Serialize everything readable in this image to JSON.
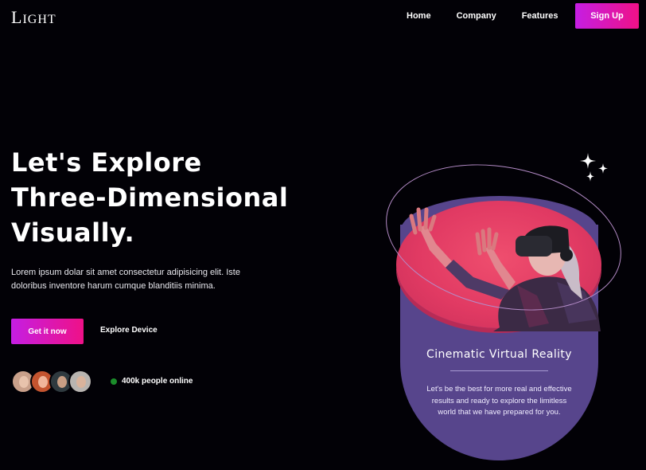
{
  "brand": {
    "first": "L",
    "rest": "IGHT"
  },
  "nav": [
    {
      "label": "Home"
    },
    {
      "label": "Company"
    },
    {
      "label": "Features"
    }
  ],
  "header": {
    "signup_label": "Sign Up"
  },
  "hero": {
    "title_lines": [
      "Let's Explore",
      "Three-Dimensional",
      "Visually."
    ],
    "description": "Lorem ipsum dolar sit amet consectetur adipisicing elit. Iste doloribus inventore harum cumque blanditiis minima.",
    "primary_cta": "Get it now",
    "secondary_cta": "Explore Device",
    "online_count": "400k people online"
  },
  "card": {
    "title": "Cinematic Virtual Reality",
    "text": "Let's be the best for more real and effective results and ready to explore the limitless world that we have prepared for you."
  },
  "colors": {
    "accent_start": "#c51ee3",
    "accent_end": "#ef1187",
    "card_purple": "#57458c",
    "disc_pink": "#e13a63",
    "online_green": "#1b8c2a",
    "background": "#020106"
  },
  "icons": [
    "sparkle-icon",
    "avatar-icon",
    "status-dot-icon"
  ]
}
